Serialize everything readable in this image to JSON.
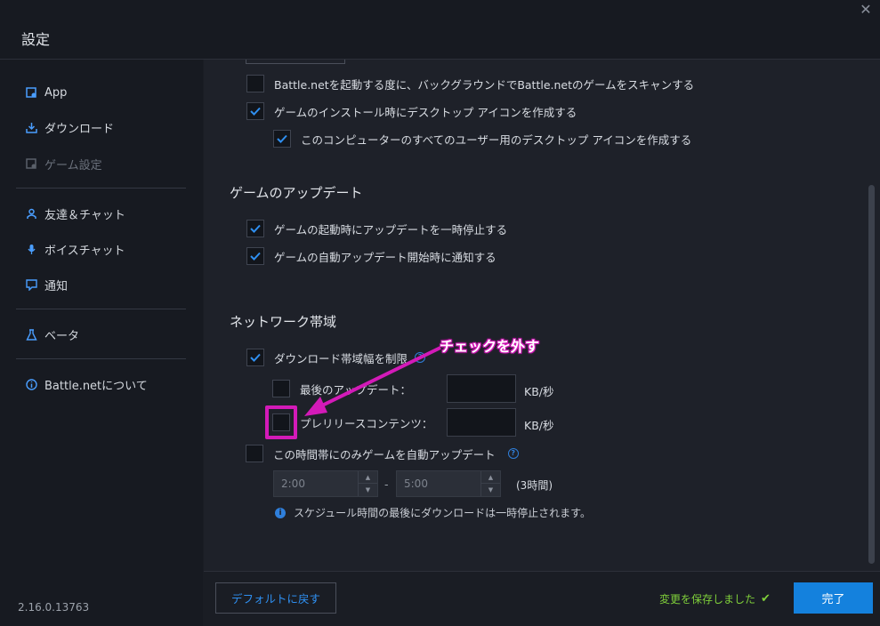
{
  "window": {
    "title": "設定",
    "close_glyph": "✕"
  },
  "sidebar": {
    "items": [
      {
        "label": "App",
        "icon": "app-gear-icon"
      },
      {
        "label": "ダウンロード",
        "icon": "download-icon"
      },
      {
        "label": "ゲーム設定",
        "icon": "game-settings-icon",
        "disabled": true
      },
      {
        "label": "友達＆チャット",
        "icon": "friends-icon"
      },
      {
        "label": "ボイスチャット",
        "icon": "microphone-icon"
      },
      {
        "label": "通知",
        "icon": "notification-icon"
      },
      {
        "label": "ベータ",
        "icon": "beta-flask-icon"
      },
      {
        "label": "Battle.netについて",
        "icon": "info-icon"
      }
    ],
    "version": "2.16.0.13763"
  },
  "install": {
    "scan_games": {
      "label": "Battle.netを起動する度に、バックグラウンドでBattle.netのゲームをスキャンする",
      "checked": false
    },
    "desktop_shortcut": {
      "label": "ゲームのインストール時にデスクトップ アイコンを作成する",
      "checked": true
    },
    "all_users_shortcut": {
      "label": "このコンピューターのすべてのユーザー用のデスクトップ アイコンを作成する",
      "checked": true
    }
  },
  "updates": {
    "title": "ゲームのアップデート",
    "pause_on_launch": {
      "label": "ゲームの起動時にアップデートを一時停止する",
      "checked": true
    },
    "notify_auto_update": {
      "label": "ゲームの自動アップデート開始時に通知する",
      "checked": true
    }
  },
  "network": {
    "title": "ネットワーク帯域",
    "limit_bandwidth": {
      "label": "ダウンロード帯域幅を制限",
      "checked": true
    },
    "latest_updates": {
      "label": "最後のアップデート：",
      "checked": false,
      "value": "",
      "unit": "KB/秒"
    },
    "prerelease": {
      "label": "プレリリースコンテンツ：",
      "checked": false,
      "value": "",
      "unit": "KB/秒"
    },
    "schedule": {
      "label": "この時間帯にのみゲームを自動アップデート",
      "checked": false
    },
    "start_time": "2:00",
    "end_time": "5:00",
    "separator": "-",
    "duration": "(3時間)",
    "info": "スケジュール時間の最後にダウンロードは一時停止されます。"
  },
  "footer": {
    "default_button": "デフォルトに戻す",
    "saved_text": "変更を保存しました",
    "done_button": "完了"
  },
  "annotation": {
    "text": "チェックを外す",
    "color": "#d31ab8"
  },
  "colors": {
    "accent": "#1481dd",
    "link": "#2f8ff0",
    "success": "#7fcf3a"
  }
}
